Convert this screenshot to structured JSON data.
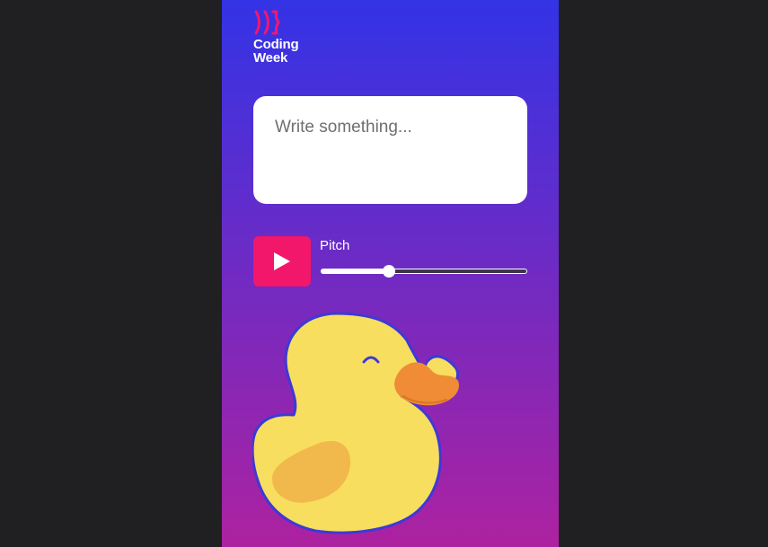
{
  "logo": {
    "line1": "Coding",
    "line2": "Week",
    "mark_color": "#f2176a"
  },
  "editor": {
    "placeholder": "Write something...",
    "value": ""
  },
  "controls": {
    "play_icon": "play-icon",
    "play_color": "#f2176a",
    "pitch_label": "Pitch",
    "pitch_fraction": 0.33
  },
  "theme": {
    "gradient_top": "#3333e6",
    "gradient_bottom": "#ad22a0",
    "duck_body": "#f8de5e",
    "duck_wing": "#f1b84b",
    "duck_beak": "#ef8c35",
    "duck_outline": "#3c3ad8"
  },
  "illustration": {
    "icon": "rubber-duck-icon"
  }
}
